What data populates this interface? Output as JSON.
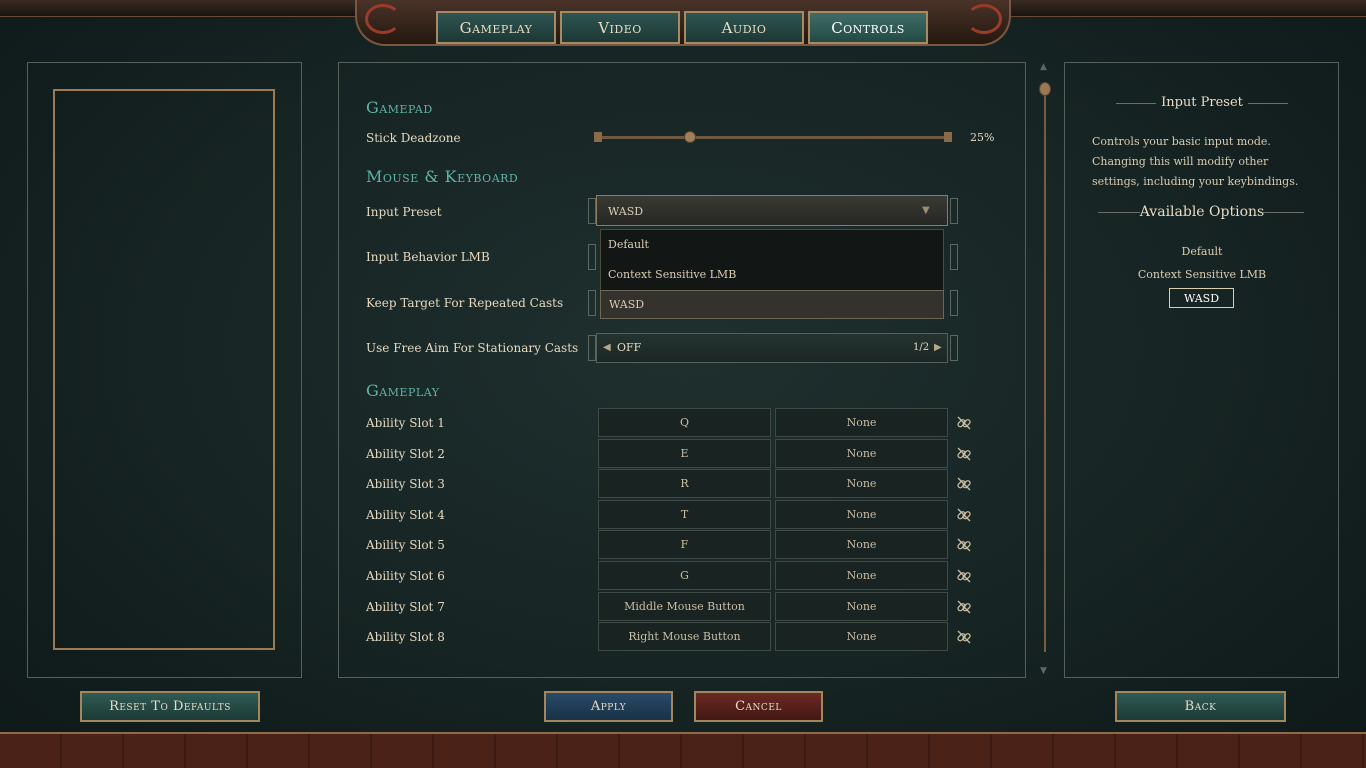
{
  "tabs": [
    "Gameplay",
    "Video",
    "Audio",
    "Controls"
  ],
  "active_tab": "Controls",
  "sections": {
    "gamepad": "Gamepad",
    "mouse_keyboard": "Mouse & Keyboard",
    "gameplay": "Gameplay"
  },
  "stick_deadzone": {
    "label": "Stick Deadzone",
    "value_text": "25%",
    "value": 0.25
  },
  "input_preset": {
    "label": "Input Preset",
    "value": "WASD",
    "options": [
      "Default",
      "Context Sensitive LMB",
      "WASD"
    ]
  },
  "input_behavior_lmb": {
    "label": "Input Behavior LMB"
  },
  "keep_target": {
    "label": "Keep Target For Repeated Casts"
  },
  "free_aim": {
    "label": "Use Free Aim For Stationary Casts",
    "value": "OFF",
    "page": "1/2"
  },
  "ability_slots": [
    {
      "label": "Ability Slot 1",
      "primary": "Q",
      "secondary": "None"
    },
    {
      "label": "Ability Slot 2",
      "primary": "E",
      "secondary": "None"
    },
    {
      "label": "Ability Slot 3",
      "primary": "R",
      "secondary": "None"
    },
    {
      "label": "Ability Slot 4",
      "primary": "T",
      "secondary": "None"
    },
    {
      "label": "Ability Slot 5",
      "primary": "F",
      "secondary": "None"
    },
    {
      "label": "Ability Slot 6",
      "primary": "G",
      "secondary": "None"
    },
    {
      "label": "Ability Slot 7",
      "primary": "Middle Mouse Button",
      "secondary": "None"
    },
    {
      "label": "Ability Slot 8",
      "primary": "Right Mouse Button",
      "secondary": "None"
    }
  ],
  "info_panel": {
    "title": "Input Preset",
    "description": "Controls your basic input mode. Changing this will modify other settings, including your keybindings.",
    "options_heading": "Available Options",
    "options": [
      "Default",
      "Context Sensitive LMB",
      "WASD"
    ],
    "selected": "WASD"
  },
  "buttons": {
    "reset": "Reset To Defaults",
    "apply": "Apply",
    "cancel": "Cancel",
    "back": "Back"
  },
  "colors": {
    "accent_teal": "#5fb3a5",
    "gold_border": "#a2865c",
    "background": "#162423"
  }
}
